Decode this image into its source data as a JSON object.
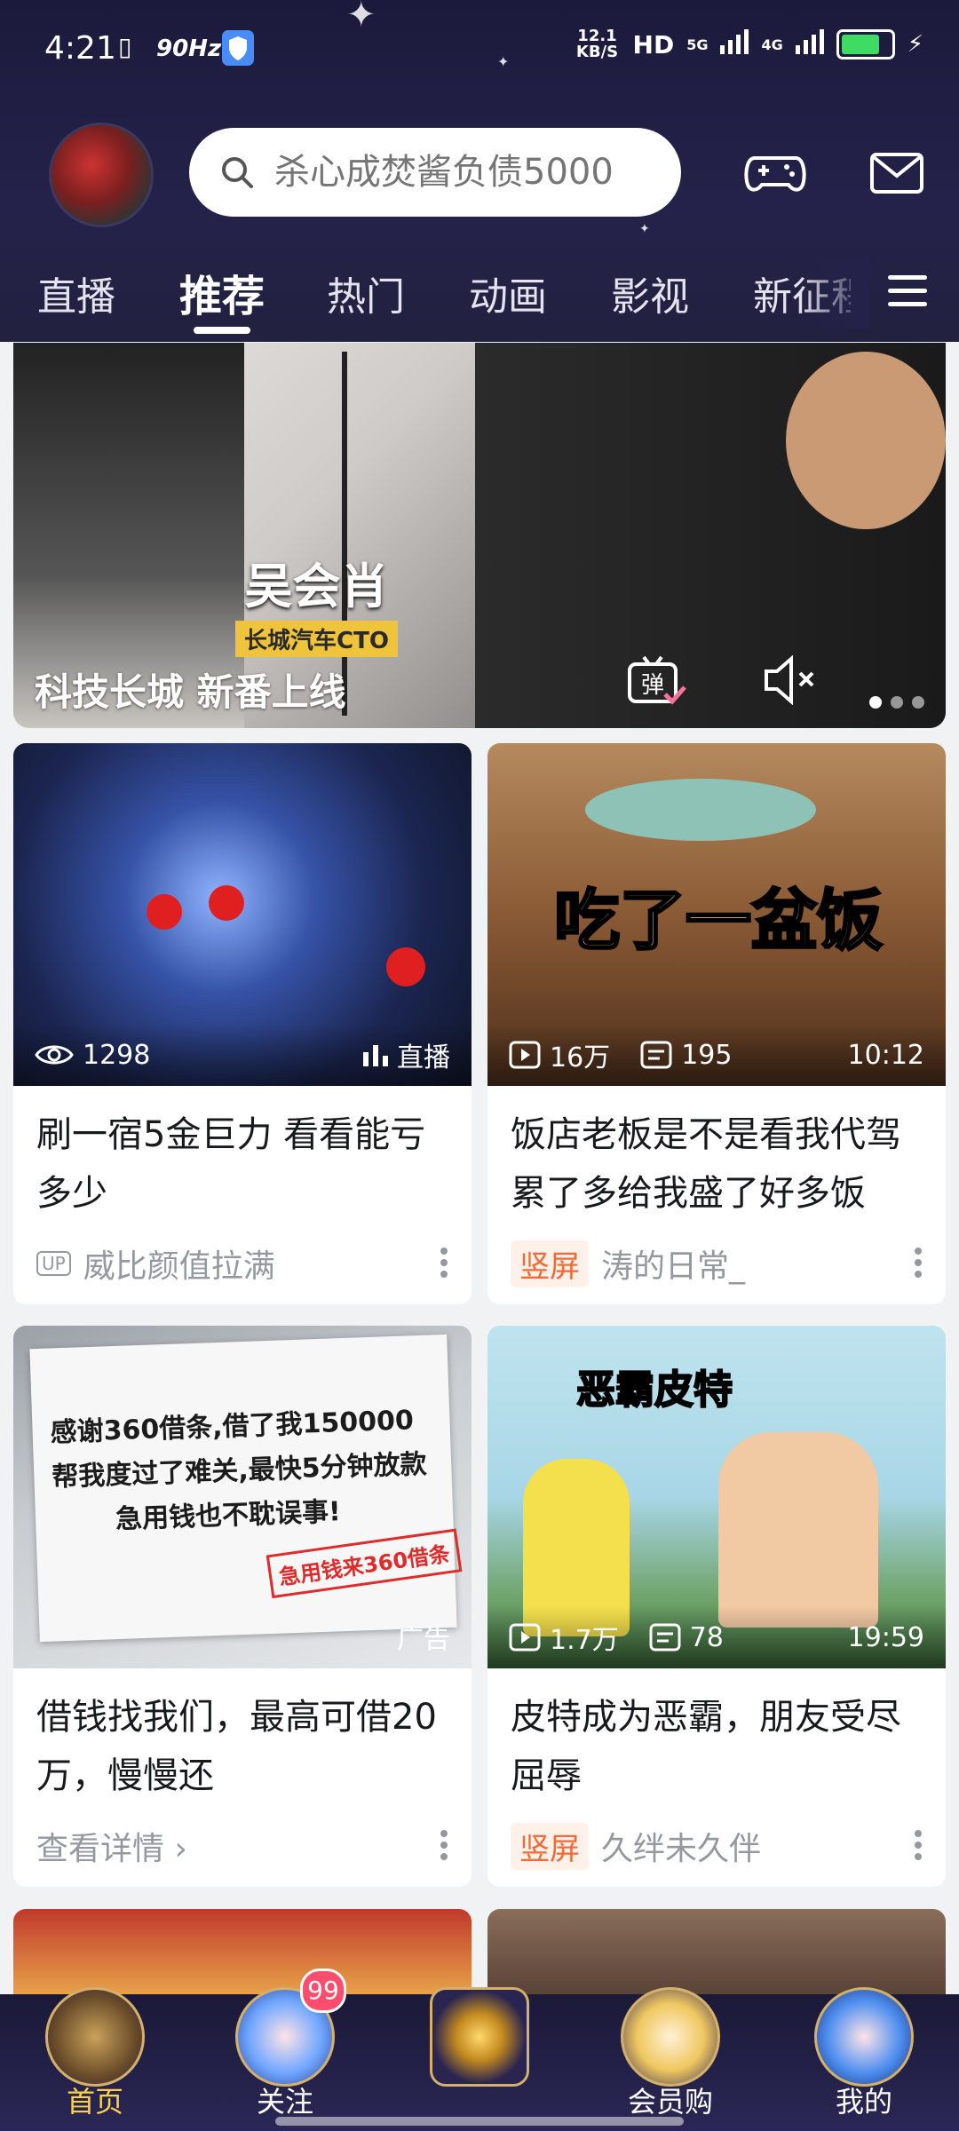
{
  "status": {
    "time": "4:21",
    "refresh": "90Hz",
    "net_speed": "12.1 KB/S",
    "hd": "HD",
    "net1": "5G",
    "net2": "4G"
  },
  "search": {
    "placeholder": "杀心成焚酱负债5000"
  },
  "tabs": {
    "items": [
      "直播",
      "推荐",
      "热门",
      "动画",
      "影视",
      "新征程"
    ],
    "active_index": 1
  },
  "banner": {
    "title": "科技长城 新番上线",
    "chyron_name": "吴会肖",
    "chyron_role": "长城汽车CTO",
    "dm_label": "弹"
  },
  "cards": [
    {
      "views": "1298",
      "badge": "直播",
      "title": "刷一宿5金巨力 看看能亏多少",
      "uploader": "威比颜值拉满",
      "up_label": "UP"
    },
    {
      "views": "16万",
      "danmaku": "195",
      "duration": "10:12",
      "overlay": "吃了一盆饭",
      "title": "饭店老板是不是看我代驾累了多给我盛了好多饭",
      "tag": "竖屏",
      "uploader": "涛的日常_"
    },
    {
      "ad_label": "广告",
      "overlay_line1": "感谢360借条,借了我150000",
      "overlay_line2": "帮我度过了难关,最快5分钟放款",
      "overlay_line3": "急用钱也不耽误事!",
      "overlay_stamp": "急用钱来360借条",
      "title": "借钱找我们，最高可借20万，慢慢还",
      "cta": "查看详情 ›"
    },
    {
      "views": "1.7万",
      "danmaku": "78",
      "duration": "19:59",
      "overlay": "恶霸皮特",
      "title": "皮特成为恶霸，朋友受尽屈辱",
      "tag": "竖屏",
      "uploader": "久绊未久伴"
    }
  ],
  "bottom_nav": {
    "items": [
      {
        "label": "首页"
      },
      {
        "label": "关注",
        "badge": "99"
      },
      {
        "label": ""
      },
      {
        "label": "会员购"
      },
      {
        "label": "我的"
      }
    ],
    "active_index": 0
  },
  "colors": {
    "header_bg": "#1f1d40",
    "active_nav": "#ffd24a",
    "tag_orange": "#f26a35",
    "badge_pink": "#ff4d6d"
  }
}
